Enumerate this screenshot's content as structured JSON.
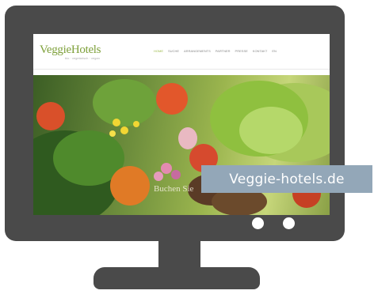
{
  "site": {
    "logo": "VeggieHotels",
    "tagline": "bio · vegetarisch · vegan",
    "nav": [
      "Home",
      "Suche",
      "Arrangements",
      "Partner",
      "Presse",
      "Kontakt",
      "EN"
    ],
    "hero_caption": "Buchen Sie"
  },
  "banner": {
    "domain": "Veggie-hotels.de"
  },
  "colors": {
    "monitor": "#4a4a4a",
    "brand_green": "#7ea03a",
    "banner_bg": "#93a7b8"
  }
}
